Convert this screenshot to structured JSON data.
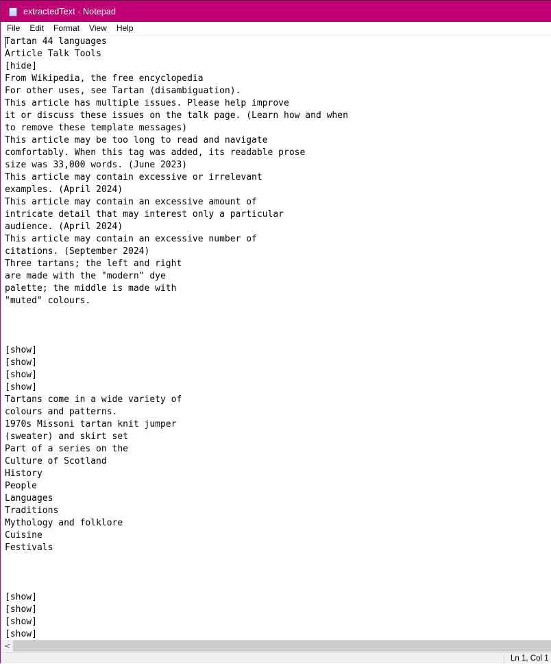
{
  "window": {
    "title": "extractedText - Notepad",
    "app_icon": "notepad-icon",
    "accent_color": "#c20076"
  },
  "menu": {
    "items": [
      "File",
      "Edit",
      "Format",
      "View",
      "Help"
    ]
  },
  "editor": {
    "lines": [
      "Tartan 44 languages",
      "Article Talk Tools",
      "[hide]",
      "From Wikipedia, the free encyclopedia",
      "For other uses, see Tartan (disambiguation).",
      "This article has multiple issues. Please help improve",
      "it or discuss these issues on the talk page. (Learn how and when",
      "to remove these template messages)",
      "This article may be too long to read and navigate",
      "comfortably. When this tag was added, its readable prose",
      "size was 33,000 words. (June 2023)",
      "This article may contain excessive or irrelevant",
      "examples. (April 2024)",
      "This article may contain an excessive amount of",
      "intricate detail that may interest only a particular",
      "audience. (April 2024)",
      "This article may contain an excessive number of",
      "citations. (September 2024)",
      "Three tartans; the left and right",
      "are made with the \"modern\" dye",
      "palette; the middle is made with",
      "\"muted\" colours.",
      "",
      "",
      "",
      "[show]",
      "[show]",
      "[show]",
      "[show]",
      "Tartans come in a wide variety of",
      "colours and patterns.",
      "1970s Missoni tartan knit jumper",
      "(sweater) and skirt set",
      "Part of a series on the",
      "Culture of Scotland",
      "History",
      "People",
      "Languages",
      "Traditions",
      "Mythology and folklore",
      "Cuisine",
      "Festivals",
      "",
      "",
      "",
      "[show]",
      "[show]",
      "[show]",
      "[show]"
    ]
  },
  "scrollbar": {
    "left_arrow_icon": "chevron-left-icon",
    "left_arrow_glyph": "<"
  },
  "status": {
    "position": "Ln 1, Col 1"
  }
}
